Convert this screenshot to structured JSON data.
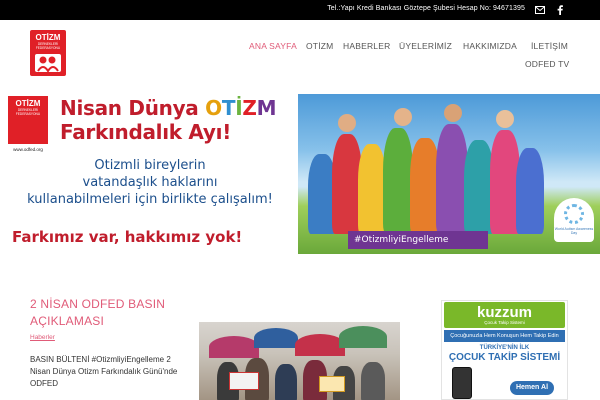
{
  "topbar": {
    "info": "Tel.:Yapı Kredi Bankası Göztepe Şubesi Hesap No: 94671395",
    "icons": [
      "email-icon",
      "facebook-icon"
    ]
  },
  "logo": {
    "line1": "OTİZM",
    "line2": "DERNEKLERİ FEDERASYONU"
  },
  "nav": {
    "items": [
      "ANA SAYFA",
      "OTİZM",
      "HABERLER",
      "ÜYELERİMİZ",
      "HAKKIMIZDA",
      "İLETİŞİM",
      "ODFED TV"
    ],
    "active_index": 0,
    "accent_color": "#e05b78"
  },
  "banner": {
    "logo_line1": "OTİZM",
    "logo_line2": "DERNEKLERİ FEDERASYONU",
    "logo_url": "www.odfed.org",
    "headline_part1": "Nisan Dünya ",
    "headline_otizm": [
      "O",
      "T",
      "İ",
      "Z",
      "M"
    ],
    "headline_line2": "Farkındalık Ayı!",
    "message_line1": "Otizmli bireylerin",
    "message_line2": "vatandaşlık haklarını",
    "message_line3": "kullanabilmeleri için birlikte çalışalım!",
    "slogan": "Farkımız var, hakkımız yok!",
    "hashtag": "#OtizmliyiEngelleme",
    "day_logo_text": "World Autism Awareness Day"
  },
  "article": {
    "title": "2 NİSAN ODFED BASIN AÇIKLAMASI",
    "category": "Haberler",
    "excerpt": "BASIN BÜLTENİ #OtizmliyiEngelleme 2 Nisan Dünya Otizm Farkındalık Günü'nde ODFED"
  },
  "ad": {
    "brand": "kuzzum",
    "brand_sub": "Çocuk Takip Sistemi",
    "strip": "Çocuğunuzla Hem Konuşun Hem Takip Edin",
    "line1": "TÜRKİYE'NİN İLK",
    "line2": "ÇOCUK TAKİP SİSTEMİ",
    "button": "Hemen Al"
  }
}
